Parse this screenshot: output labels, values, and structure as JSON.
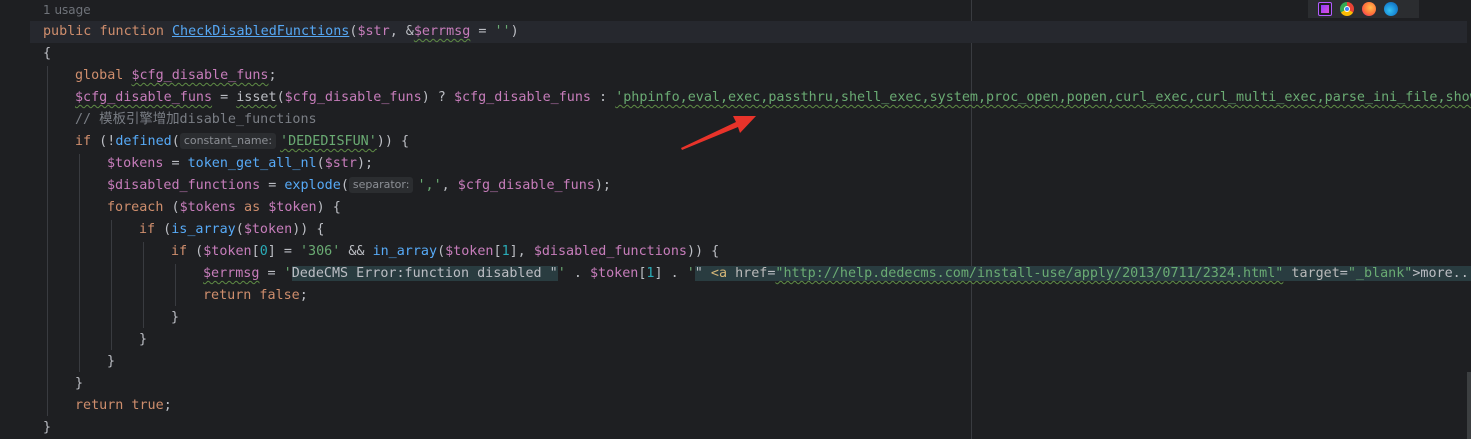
{
  "hint": {
    "usages": "1 usage"
  },
  "browsers": [
    "phpstorm-icon",
    "chrome-icon",
    "firefox-icon",
    "edge-icon"
  ],
  "code": {
    "l1": {
      "kw1": "public",
      "kw2": "function",
      "name": "CheckDisabledFunctions",
      "p1": "(",
      "v1": "$str",
      "p2": ", &",
      "v2": "$errmsg",
      "p3": " = ",
      "s1": "''",
      "p4": ")"
    },
    "l2": {
      "t": "{"
    },
    "l3": {
      "kw": "global",
      "v": "$cfg_disable_funs",
      "p": ";"
    },
    "l4": {
      "v1": "$cfg_disable_funs",
      "p1": " = ",
      "fn": "isset",
      "p2": "(",
      "v2": "$cfg_disable_funs",
      "p3": ") ? ",
      "v3": "$cfg_disable_funs",
      "p4": " : ",
      "s": "'phpinfo,eval,exec,passthru,shell_exec,system,proc_open,popen,curl_exec,curl_multi_exec,parse_ini_file,show_"
    },
    "l5": {
      "c": "// 模板引擎增加disable_functions"
    },
    "l6": {
      "kw": "if",
      "p1": " (!",
      "fn": "defined",
      "p2": "(",
      "hint": "constant_name:",
      "s": "'DEDEDISFUN'",
      "p3": ")) {"
    },
    "l7": {
      "v1": "$tokens",
      "p1": " = ",
      "fn": "token_get_all_nl",
      "p2": "(",
      "v2": "$str",
      "p3": ");"
    },
    "l8": {
      "v1": "$disabled_functions",
      "p1": " = ",
      "fn": "explode",
      "p2": "(",
      "hint": "separator:",
      "s": "','",
      "p3": ", ",
      "v2": "$cfg_disable_funs",
      "p4": ");"
    },
    "l9": {
      "kw1": "foreach",
      "p1": " (",
      "v1": "$tokens",
      "kw2": " as ",
      "v2": "$token",
      "p2": ") {"
    },
    "l10": {
      "kw": "if",
      "p1": " (",
      "fn": "is_array",
      "p2": "(",
      "v": "$token",
      "p3": ")) {"
    },
    "l11": {
      "kw": "if",
      "p1": " (",
      "v1": "$token",
      "p2": "[",
      "n1": "0",
      "p3": "] = ",
      "s": "'306'",
      "p4": " && ",
      "fn": "in_array",
      "p5": "(",
      "v2": "$token",
      "p6": "[",
      "n2": "1",
      "p7": "], ",
      "v3": "$disabled_functions",
      "p8": ")) {"
    },
    "l12": {
      "v1": "$errmsg",
      "p1": " = ",
      "s1": "'",
      "inj1": "DedeCMS Error:function disabled \"",
      "s2": "'",
      "p2": " . ",
      "v2": "$token",
      "p3": "[",
      "n": "1",
      "p4": "] . ",
      "s3": "'",
      "inj2a": "\" ",
      "tag": "<a ",
      "a1": "href",
      "eq1": "=",
      "href": "\"http://help.dedecms.com/install-use/apply/2013/0711/2324.html\"",
      "sp": " ",
      "a2": "target",
      "eq2": "=",
      "tgt": "\"_blank\"",
      "tagend": ">more...<"
    },
    "l13": {
      "kw1": "return",
      "kw2": " false",
      "p": ";"
    },
    "l14": {
      "t": "}"
    },
    "l15": {
      "t": "}"
    },
    "l16": {
      "t": "}"
    },
    "l17": {
      "t": "}"
    },
    "l18": {
      "kw1": "return",
      "kw2": " true",
      "p": ";"
    },
    "l19": {
      "t": "}"
    }
  },
  "colors": {
    "background": "#1e1f22",
    "keyword": "#cf8e6d",
    "variable": "#c77dbb",
    "function": "#57aaf7",
    "string": "#6aab73",
    "number": "#2aacb8",
    "comment": "#7a7e85",
    "arrow": "#e8332a"
  }
}
